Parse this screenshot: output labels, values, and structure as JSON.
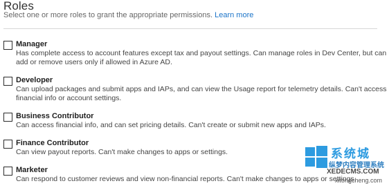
{
  "header": {
    "title": "Roles",
    "subtitle": "Select one or more roles to grant the appropriate permissions.",
    "learn_more": "Learn more"
  },
  "roles": [
    {
      "name": "Manager",
      "description": "Has complete access to account features except tax and payout settings. Can manage roles in Dev Center, but can add or remove users only if allowed in Azure AD.",
      "checked": false
    },
    {
      "name": "Developer",
      "description": "Can upload packages and submit apps and IAPs, and can view the Usage report for telemetry details. Can't access financial info or account settings.",
      "checked": false
    },
    {
      "name": "Business Contributor",
      "description": "Can access financial info, and can set pricing details. Can't create or submit new apps and IAPs.",
      "checked": false
    },
    {
      "name": "Finance Contributor",
      "description": "Can view payout reports. Can't make changes to apps or settings.",
      "checked": false
    },
    {
      "name": "Marketer",
      "description": "Can respond to customer reviews and view non-financial reports. Can't make changes to apps or settings.",
      "checked": false
    }
  ],
  "watermark": {
    "title": "系统城",
    "subtitle": "纵梦内容管理系统",
    "url": "XEDECMS.COM",
    "url2": "xitongcheng.com"
  },
  "colors": {
    "link": "#1a73c8",
    "text": "#2b2b2b",
    "watermark": "#2d9be0"
  }
}
